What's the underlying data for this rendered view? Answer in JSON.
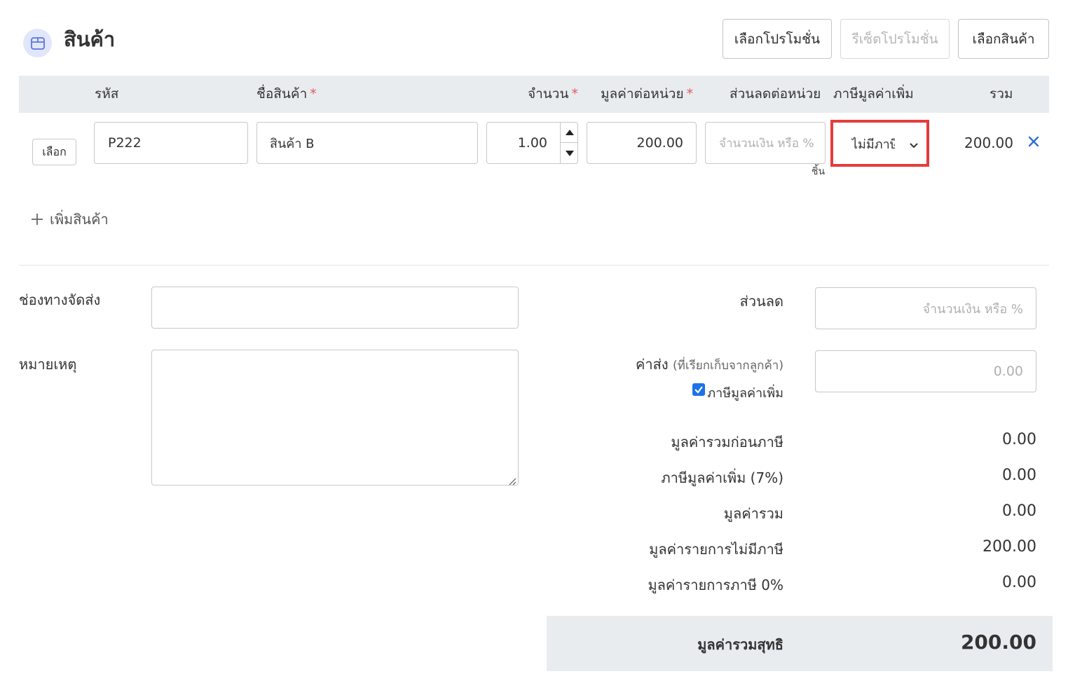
{
  "header": {
    "title": "สินค้า",
    "buttons": {
      "select_promotion": "เลือกโปรโมชั่น",
      "reset_promotion": "รีเซ็ตโปรโมชั่น",
      "select_product": "เลือกสินค้า"
    }
  },
  "table": {
    "columns": {
      "code": "รหัส",
      "name": "ชื่อสินค้า",
      "quantity": "จำนวน",
      "unit_price": "มูลค่าต่อหน่วย",
      "discount_per_unit": "ส่วนลดต่อหน่วย",
      "vat": "ภาษีมูลค่าเพิ่ม",
      "total": "รวม"
    },
    "required_mark": "*",
    "rows": [
      {
        "select_label": "เลือก",
        "code": "P222",
        "name": "สินค้า B",
        "quantity": "1.00",
        "unit_price": "200.00",
        "discount_placeholder": "จำนวนเงิน หรือ %",
        "unit": "ชิ้น",
        "vat": "ไม่มีภาษี",
        "total": "200.00"
      }
    ],
    "add_item_label": "เพิ่มสินค้า"
  },
  "form": {
    "shipping_channel_label": "ช่องทางจัดส่ง",
    "shipping_channel_value": "",
    "note_label": "หมายเหตุ",
    "note_value": ""
  },
  "summary": {
    "discount_label": "ส่วนลด",
    "discount_placeholder": "จำนวนเงิน หรือ %",
    "shipping_fee_label": "ค่าส่ง",
    "shipping_fee_sub": "(ที่เรียกเก็บจากลูกค้า)",
    "shipping_fee_placeholder": "0.00",
    "vat_checkbox_label": "ภาษีมูลค่าเพิ่ม",
    "vat_checked": true,
    "rows": [
      {
        "label": "มูลค่ารวมก่อนภาษี",
        "value": "0.00"
      },
      {
        "label": "ภาษีมูลค่าเพิ่ม (7%)",
        "value": "0.00"
      },
      {
        "label": "มูลค่ารวม",
        "value": "0.00"
      },
      {
        "label": "มูลค่ารายการไม่มีภาษี",
        "value": "200.00"
      },
      {
        "label": "มูลค่ารายการภาษี 0%",
        "value": "0.00"
      }
    ],
    "net_total_label": "มูลค่ารวมสุทธิ",
    "net_total_value": "200.00"
  },
  "colors": {
    "accent": "#1a73e8",
    "highlight": "#e43c3c",
    "required": "#e05a5a",
    "header_bg": "#e9ecef",
    "remove_icon": "#2f6fd6"
  },
  "icons": {
    "title_icon": "box-icon",
    "remove": "close-icon",
    "add": "plus-icon",
    "dropdown": "chevron-down-icon",
    "stepper_up": "caret-up-icon",
    "stepper_down": "caret-down-icon"
  }
}
